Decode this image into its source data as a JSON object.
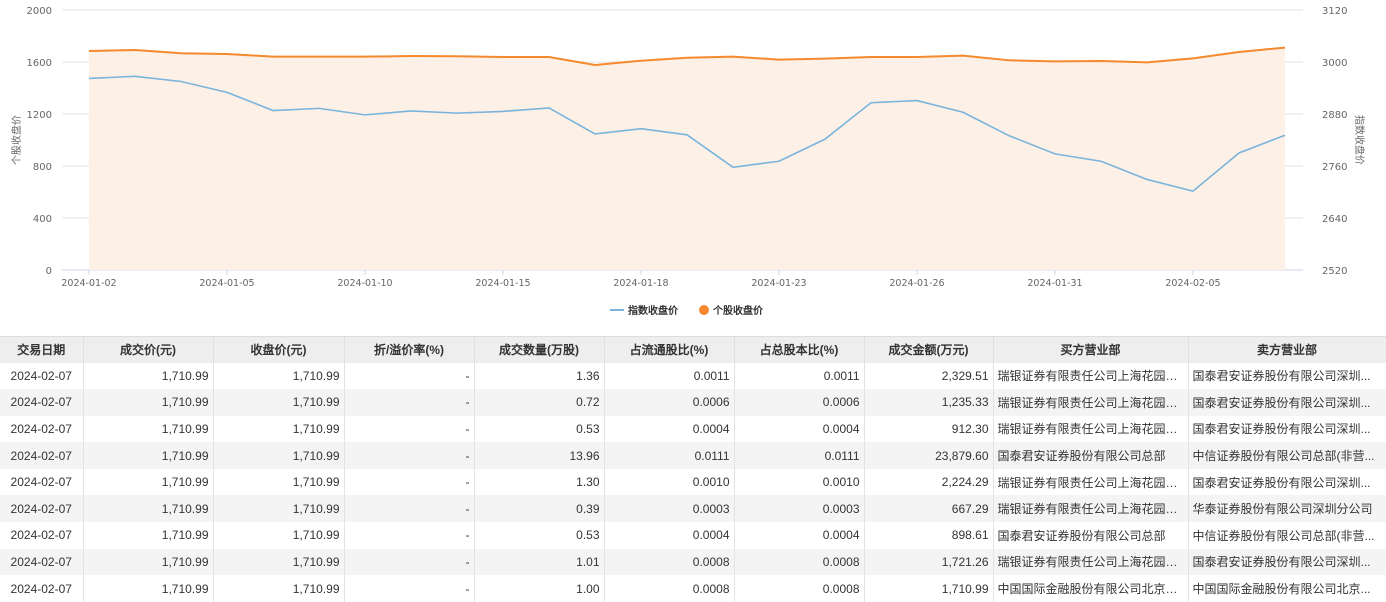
{
  "chart_data": {
    "type": "line",
    "x": [
      "2024-01-02",
      "2024-01-03",
      "2024-01-04",
      "2024-01-05",
      "2024-01-08",
      "2024-01-09",
      "2024-01-10",
      "2024-01-11",
      "2024-01-12",
      "2024-01-15",
      "2024-01-16",
      "2024-01-17",
      "2024-01-18",
      "2024-01-19",
      "2024-01-22",
      "2024-01-23",
      "2024-01-24",
      "2024-01-25",
      "2024-01-26",
      "2024-01-29",
      "2024-01-30",
      "2024-01-31",
      "2024-02-01",
      "2024-02-02",
      "2024-02-05",
      "2024-02-06",
      "2024-02-07"
    ],
    "xticks": [
      "2024-01-02",
      "2024-01-05",
      "2024-01-10",
      "2024-01-15",
      "2024-01-18",
      "2024-01-23",
      "2024-01-26",
      "2024-01-31",
      "2024-02-05"
    ],
    "series": [
      {
        "name": "指数收盘价",
        "axis": "right",
        "color": "#7ab4dc",
        "values": [
          2962,
          2967,
          2955,
          2930,
          2888,
          2893,
          2878,
          2887,
          2882,
          2886,
          2894,
          2834,
          2846,
          2832,
          2757,
          2771,
          2822,
          2906,
          2911,
          2884,
          2830,
          2788,
          2771,
          2729,
          2702,
          2790,
          2831
        ]
      },
      {
        "name": "个股收盘价",
        "axis": "left",
        "color": "#f5892e",
        "area": true,
        "area_color": "#fdf0e6",
        "values": [
          1685,
          1692,
          1667,
          1662,
          1641,
          1641,
          1641,
          1646,
          1644,
          1638,
          1638,
          1577,
          1610,
          1633,
          1641,
          1618,
          1626,
          1638,
          1638,
          1649,
          1613,
          1605,
          1608,
          1597,
          1628,
          1677,
          1710.99
        ]
      }
    ],
    "ylabel_left": "个股收盘价",
    "ylabel_right": "指数收盘价",
    "ylim_left": [
      0,
      2000
    ],
    "yticks_left": [
      "0",
      "400",
      "800",
      "1200",
      "1600",
      "2000"
    ],
    "ylim_right": [
      2520,
      3120
    ],
    "yticks_right": [
      "2520",
      "2640",
      "2760",
      "2880",
      "3000",
      "3120"
    ],
    "grid": true,
    "legend": "bottom-center"
  },
  "table": {
    "headers": [
      "交易日期",
      "成交价(元)",
      "收盘价(元)",
      "折/溢价率(%)",
      "成交数量(万股)",
      "占流通股比(%)",
      "占总股本比(%)",
      "成交金额(万元)",
      "买方营业部",
      "卖方营业部"
    ],
    "rows": [
      [
        "2024-02-07",
        "1,710.99",
        "1,710.99",
        "-",
        "1.36",
        "0.0011",
        "0.0011",
        "2,329.51",
        "瑞银证券有限责任公司上海花园石...",
        "国泰君安证券股份有限公司深圳..."
      ],
      [
        "2024-02-07",
        "1,710.99",
        "1,710.99",
        "-",
        "0.72",
        "0.0006",
        "0.0006",
        "1,235.33",
        "瑞银证券有限责任公司上海花园石...",
        "国泰君安证券股份有限公司深圳..."
      ],
      [
        "2024-02-07",
        "1,710.99",
        "1,710.99",
        "-",
        "0.53",
        "0.0004",
        "0.0004",
        "912.30",
        "瑞银证券有限责任公司上海花园石...",
        "国泰君安证券股份有限公司深圳..."
      ],
      [
        "2024-02-07",
        "1,710.99",
        "1,710.99",
        "-",
        "13.96",
        "0.0111",
        "0.0111",
        "23,879.60",
        "国泰君安证券股份有限公司总部",
        "中信证券股份有限公司总部(非营..."
      ],
      [
        "2024-02-07",
        "1,710.99",
        "1,710.99",
        "-",
        "1.30",
        "0.0010",
        "0.0010",
        "2,224.29",
        "瑞银证券有限责任公司上海花园石...",
        "国泰君安证券股份有限公司深圳..."
      ],
      [
        "2024-02-07",
        "1,710.99",
        "1,710.99",
        "-",
        "0.39",
        "0.0003",
        "0.0003",
        "667.29",
        "瑞银证券有限责任公司上海花园石...",
        "华泰证券股份有限公司深圳分公司"
      ],
      [
        "2024-02-07",
        "1,710.99",
        "1,710.99",
        "-",
        "0.53",
        "0.0004",
        "0.0004",
        "898.61",
        "国泰君安证券股份有限公司总部",
        "中信证券股份有限公司总部(非营..."
      ],
      [
        "2024-02-07",
        "1,710.99",
        "1,710.99",
        "-",
        "1.01",
        "0.0008",
        "0.0008",
        "1,721.26",
        "瑞银证券有限责任公司上海花园石...",
        "国泰君安证券股份有限公司深圳..."
      ],
      [
        "2024-02-07",
        "1,710.99",
        "1,710.99",
        "-",
        "1.00",
        "0.0008",
        "0.0008",
        "1,710.99",
        "中国国际金融股份有限公司北京建...",
        "中国国际金融股份有限公司北京..."
      ]
    ]
  }
}
